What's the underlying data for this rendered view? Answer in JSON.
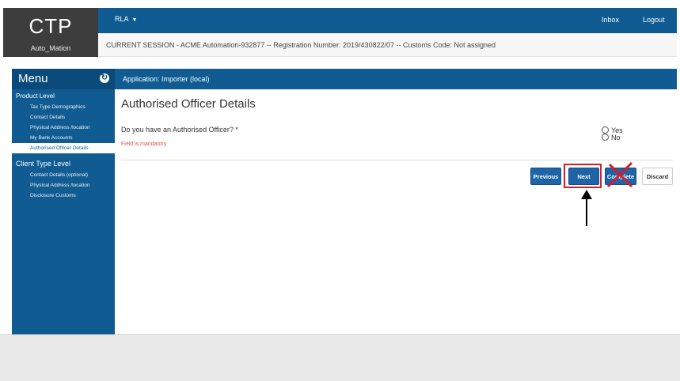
{
  "header": {
    "brand": "CTP",
    "user": "Auto_Mation",
    "role_menu": "RLA",
    "inbox": "Inbox",
    "logout": "Logout",
    "session_text": "CURRENT SESSION - ACME Automation-932877 -- Registration Number: 2019/430822/07 -- Customs Code: Not assigned"
  },
  "sidebar": {
    "title": "Menu",
    "sections": [
      {
        "title": "Product Level",
        "items": [
          "Tax Type Demographics",
          "Contact Details",
          "Physical Address /location",
          "My Bank Accounts",
          "Authorised Officer Details"
        ],
        "active_index": 4
      },
      {
        "title": "Client Type Level",
        "items": [
          "Contact Details (optional)",
          "Physical Address /location",
          "Disclosure Customs"
        ]
      }
    ]
  },
  "app_bar": "Application: Importer (local)",
  "main": {
    "title": "Authorised Officer Details",
    "question": "Do you have an Authorised Officer? *",
    "mandatory_msg": "Field is mandatory",
    "options": [
      "Yes",
      "No"
    ],
    "selected_option": null
  },
  "buttons": {
    "previous": "Previous",
    "next": "Next",
    "complete": "Complete",
    "discard": "Discard"
  },
  "colors": {
    "primary_blue": "#0f5b92",
    "annotation_red": "#d81b2c",
    "error_text": "#d9534f"
  }
}
